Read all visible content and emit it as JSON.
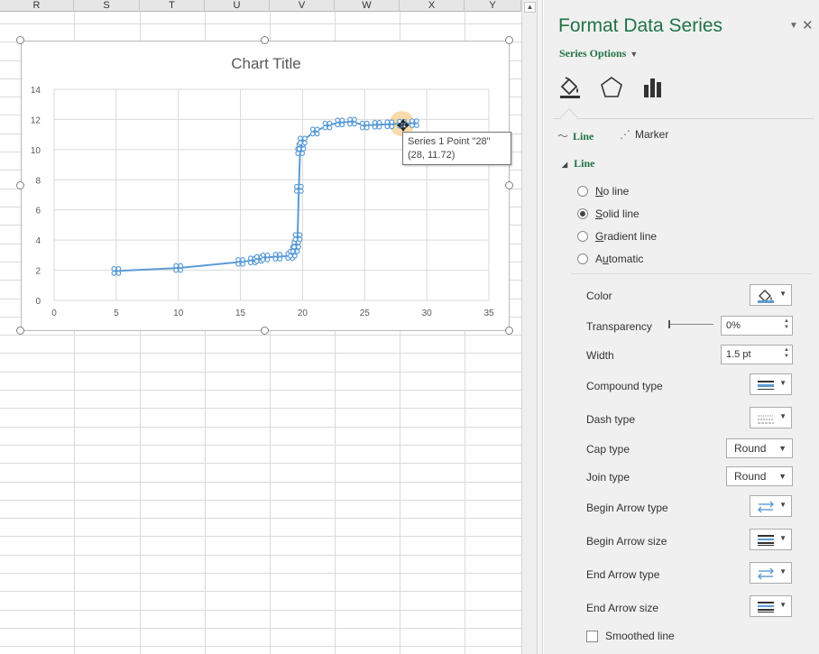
{
  "sheet": {
    "columns": [
      "R",
      "S",
      "T",
      "U",
      "V",
      "W",
      "X",
      "Y"
    ]
  },
  "chart_data": {
    "type": "scatter",
    "title": "Chart Title",
    "xlabel": "",
    "ylabel": "",
    "xlim": [
      0,
      35
    ],
    "ylim": [
      0,
      14
    ],
    "x_ticks": [
      "0",
      "5",
      "10",
      "15",
      "20",
      "25",
      "30",
      "35"
    ],
    "y_ticks": [
      "0",
      "2",
      "4",
      "6",
      "8",
      "10",
      "12",
      "14"
    ],
    "grid": true,
    "legend": "none",
    "series": [
      {
        "color": "#5b9bd5",
        "points": [
          [
            5,
            1.95
          ],
          [
            10,
            2.15
          ],
          [
            15,
            2.55
          ],
          [
            16,
            2.65
          ],
          [
            16.5,
            2.75
          ],
          [
            17,
            2.85
          ],
          [
            18,
            2.9
          ],
          [
            19,
            2.95
          ],
          [
            19.2,
            3.1
          ],
          [
            19.4,
            3.4
          ],
          [
            19.5,
            3.7
          ],
          [
            19.6,
            4.2
          ],
          [
            19.7,
            7.4
          ],
          [
            19.8,
            9.9
          ],
          [
            19.9,
            10.2
          ],
          [
            20,
            10.6
          ],
          [
            21,
            11.2
          ],
          [
            22,
            11.6
          ],
          [
            23,
            11.8
          ],
          [
            24,
            11.85
          ],
          [
            25,
            11.6
          ],
          [
            26,
            11.65
          ],
          [
            27,
            11.68
          ],
          [
            28,
            11.72
          ],
          [
            29,
            11.75
          ]
        ]
      }
    ]
  },
  "tooltip": {
    "line1": "Series 1 Point \"28\"",
    "line2": "(28, 11.72)"
  },
  "pane": {
    "title": "Format Data Series",
    "series_options": "Series Options",
    "icons": [
      "fill-line-icon",
      "effects-icon",
      "series-options-icon"
    ],
    "subtab_line": "Line",
    "subtab_marker": "Marker",
    "section_line": "Line",
    "radios": [
      {
        "label": "No line",
        "ul": "N",
        "rest": "o line",
        "checked": false
      },
      {
        "label": "Solid line",
        "ul": "S",
        "rest": "olid line",
        "checked": true
      },
      {
        "label": "Gradient line",
        "ul": "G",
        "rest": "radient line",
        "checked": false
      },
      {
        "label": "Automatic",
        "ul": "u",
        "pre": "A",
        "rest": "tomatic",
        "checked": false
      }
    ],
    "props": {
      "color_label": "Color",
      "transparency_label": "Transparency",
      "transparency_value": "0%",
      "width_label": "Width",
      "width_value": "1.5 pt",
      "compound_label": "Compound type",
      "dash_label": "Dash type",
      "cap_label": "Cap type",
      "cap_value": "Round",
      "join_label": "Join type",
      "join_value": "Round",
      "begin_arrow_type_label": "Begin Arrow type",
      "begin_arrow_size_label": "Begin Arrow size",
      "end_arrow_type_label": "End Arrow type",
      "end_arrow_size_label": "End Arrow size",
      "smoothed_label": "Smoothed line"
    },
    "colors": {
      "accent": "#217346",
      "series": "#5b9bd5"
    }
  }
}
